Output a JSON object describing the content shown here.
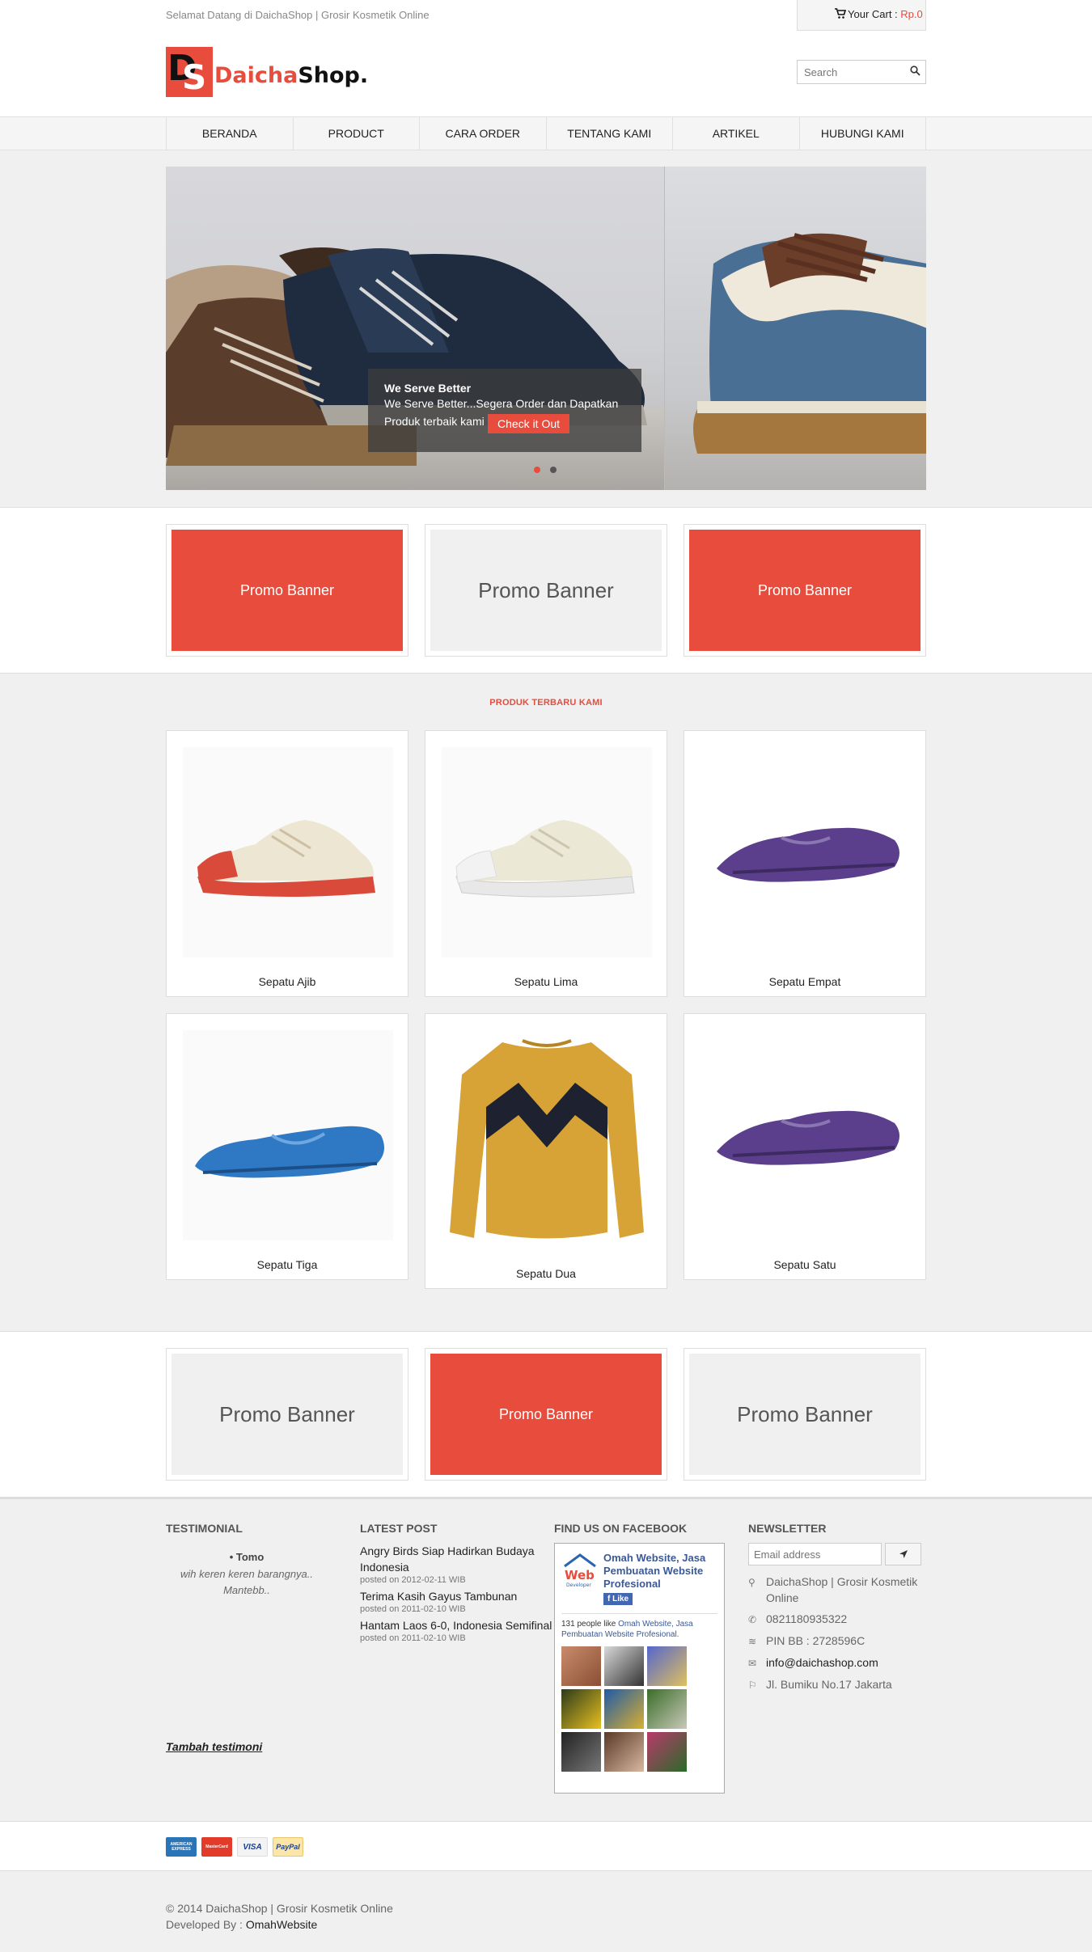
{
  "topbar": {
    "welcome": "Selamat Datang di DaichaShop | Grosir Kosmetik Online",
    "cart_label": "Your Cart :",
    "cart_amount": "Rp.0"
  },
  "logo": {
    "part1": "Daicha",
    "part2": "Shop.",
    "mark1": "D",
    "mark2": "S"
  },
  "search": {
    "placeholder": "Search"
  },
  "nav": [
    "BERANDA",
    "PRODUCT",
    "CARA ORDER",
    "TENTANG KAMI",
    "ARTIKEL",
    "HUBUNGI KAMI"
  ],
  "slider": {
    "title": "We Serve Better",
    "text": "We Serve Better...Segera Order dan Dapatkan Produk terbaik kami",
    "button": "Check it Out",
    "slides": 2,
    "active": 1
  },
  "promos_top": [
    {
      "label": "Promo Banner",
      "style": "red"
    },
    {
      "label": "Promo Banner",
      "style": "grey"
    },
    {
      "label": "Promo Banner",
      "style": "red"
    }
  ],
  "products": {
    "title": "PRODUK TERBARU KAMI",
    "items": [
      {
        "name": "Sepatu Ajib",
        "kind": "sneaker",
        "color": "#d94a3a"
      },
      {
        "name": "Sepatu Lima",
        "kind": "sneaker",
        "color": "#e8e8e8"
      },
      {
        "name": "Sepatu Empat",
        "kind": "loafer",
        "color": "#5b3f8c"
      },
      {
        "name": "Sepatu Tiga",
        "kind": "loafer",
        "color": "#2f78c4"
      },
      {
        "name": "Sepatu Dua",
        "kind": "sweater",
        "color": "#d8a336"
      },
      {
        "name": "Sepatu Satu",
        "kind": "loafer",
        "color": "#5b3f8c"
      }
    ]
  },
  "promos_bottom": [
    {
      "label": "Promo Banner",
      "style": "grey"
    },
    {
      "label": "Promo Banner",
      "style": "red"
    },
    {
      "label": "Promo Banner",
      "style": "grey"
    }
  ],
  "footer": {
    "testimonial": {
      "heading": "TESTIMONIAL",
      "name": "Tomo",
      "text": "wih keren keren barangnya.. Mantebb..",
      "add": "Tambah testimoni"
    },
    "latest": {
      "heading": "LATEST POST",
      "posts": [
        {
          "title": "Angry Birds Siap Hadirkan Budaya Indonesia",
          "date": "posted on 2012-02-11 WIB"
        },
        {
          "title": "Terima Kasih Gayus Tambunan",
          "date": "posted on 2011-02-10 WIB"
        },
        {
          "title": "Hantam Laos 6-0, Indonesia Semifinal",
          "date": "posted on 2011-02-10 WIB"
        }
      ]
    },
    "facebook": {
      "heading": "FIND US ON FACEBOOK",
      "page_name": "Omah Website, Jasa Pembuatan Website Profesional",
      "like": "Like",
      "count_text": "131 people like",
      "count_link": "Omah Website, Jasa Pembuatan Website Profesional."
    },
    "newsletter": {
      "heading": "NEWSLETTER",
      "placeholder": "Email address",
      "contacts": [
        {
          "icon": "map-marker-icon",
          "text": "DaichaShop | Grosir Kosmetik Online"
        },
        {
          "icon": "phone-icon",
          "text": "0821180935322"
        },
        {
          "icon": "signal-icon",
          "text": "PIN BB : 2728596C"
        },
        {
          "icon": "envelope-icon",
          "text": "info@daichashop.com"
        },
        {
          "icon": "signpost-icon",
          "text": "Jl. Bumiku No.17 Jakarta"
        }
      ]
    }
  },
  "payments": [
    "AMERICAN EXPRESS",
    "MasterCard",
    "VISA",
    "PayPal"
  ],
  "copyright": {
    "text": "© 2014 DaichaShop | Grosir Kosmetik Online",
    "dev_label": "Developed By :",
    "dev_name": "OmahWebsite"
  },
  "colors": {
    "accent": "#e74c3c",
    "bg_band": "#f0f0f0",
    "fb_blue": "#3b5998"
  }
}
